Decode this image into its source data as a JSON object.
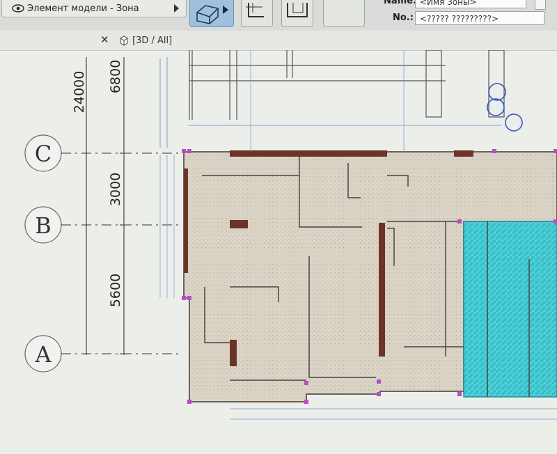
{
  "toolbar": {
    "filter_label": "Элемент модели - Зона",
    "name_label": "Name:",
    "name_value": "<Имя Зоны>",
    "no_label": "No.:",
    "no_value": "<????? ?????????>"
  },
  "tabs": [
    {
      "label": "[3D / All]"
    }
  ],
  "grid": {
    "axes": [
      "C",
      "B",
      "A"
    ],
    "total_dimension": "24000",
    "spans": [
      "6800",
      "3000",
      "5600"
    ]
  },
  "colors": {
    "floor_fill": "#d8d0c2",
    "zone_fill": "#3fc9d3",
    "wall_dark": "#6a3526",
    "selection": "#b84cc4",
    "dimension_line": "#6688bb"
  }
}
